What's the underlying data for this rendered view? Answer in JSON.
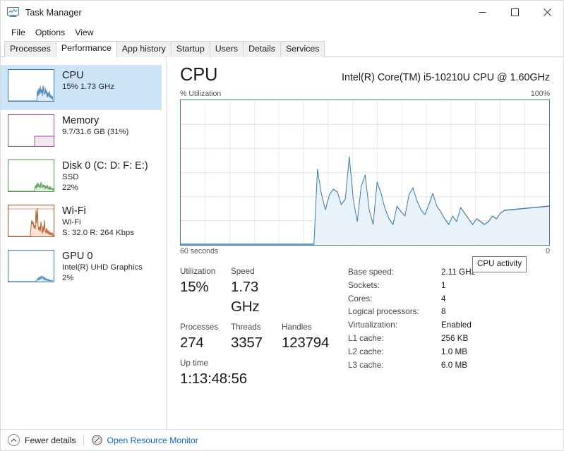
{
  "window": {
    "title": "Task Manager",
    "icon": "task-manager-icon",
    "caption": {
      "minimize": "─",
      "maximize": "□",
      "close": "✕"
    }
  },
  "menubar": {
    "items": [
      "File",
      "Options",
      "View"
    ]
  },
  "tabs": {
    "active": "Performance",
    "items": [
      "Processes",
      "Performance",
      "App history",
      "Startup",
      "Users",
      "Details",
      "Services"
    ]
  },
  "sidebar": {
    "items": [
      {
        "name": "CPU",
        "title": "CPU",
        "sub1": "15%  1.73 GHz",
        "sub2": "",
        "selected": true,
        "color": "#4a90c4"
      },
      {
        "name": "Memory",
        "title": "Memory",
        "sub1": "9.7/31.6 GB (31%)",
        "sub2": "",
        "selected": false,
        "color": "#9b4f96"
      },
      {
        "name": "Disk 0",
        "title": "Disk 0 (C: D: F: E:)",
        "sub1": "SSD",
        "sub2": "22%",
        "selected": false,
        "color": "#4e9a4e"
      },
      {
        "name": "Wi-Fi",
        "title": "Wi-Fi",
        "sub1": "Wi-Fi",
        "sub2": "S: 32.0 R: 264 Kbps",
        "selected": false,
        "color": "#b4521e"
      },
      {
        "name": "GPU 0",
        "title": "GPU 0",
        "sub1": "Intel(R) UHD Graphics",
        "sub2": "2%",
        "selected": false,
        "color": "#3a7cb0"
      }
    ]
  },
  "main": {
    "title": "CPU",
    "model": "Intel(R) Core(TM) i5-10210U CPU @ 1.60GHz",
    "graph_top_left": "% Utilization",
    "graph_top_right": "100%",
    "graph_bottom_left": "60 seconds",
    "graph_bottom_right": "0",
    "tooltip": "CPU activity"
  },
  "stats": {
    "left": [
      {
        "label": "Utilization",
        "value": "15%"
      },
      {
        "label": "Speed",
        "value": "1.73 GHz"
      },
      {
        "label": "Processes",
        "value": "274"
      },
      {
        "label": "Threads",
        "value": "3357"
      },
      {
        "label": "Handles",
        "value": "123794"
      },
      {
        "label": "Up time",
        "value": "1:13:48:56"
      }
    ],
    "right": [
      {
        "key": "Base speed:",
        "value": "2.11 GHz"
      },
      {
        "key": "Sockets:",
        "value": "1"
      },
      {
        "key": "Cores:",
        "value": "4"
      },
      {
        "key": "Logical processors:",
        "value": "8"
      },
      {
        "key": "Virtualization:",
        "value": "Enabled"
      },
      {
        "key": "L1 cache:",
        "value": "256 KB"
      },
      {
        "key": "L2 cache:",
        "value": "1.0 MB"
      },
      {
        "key": "L3 cache:",
        "value": "6.0 MB"
      }
    ]
  },
  "footer": {
    "fewer_details": "Fewer details",
    "resource_monitor": "Open Resource Monitor"
  },
  "colors": {
    "accent_line": "#3a7cb0",
    "accent_fill": "#e8f1f8",
    "selection": "#cce4f7",
    "link": "#0966c2"
  },
  "chart_data": {
    "type": "area",
    "title": "% Utilization",
    "xlabel": "60 seconds",
    "ylabel": "% Utilization",
    "xlim": [
      60,
      0
    ],
    "ylim": [
      0,
      100
    ],
    "grid": true,
    "grid_cols": 15,
    "grid_rows": 5,
    "series": [
      {
        "name": "CPU activity",
        "color": "#3a7cb0",
        "x": [
          60,
          38,
          37.2,
          36.4,
          35.6,
          34.8,
          34,
          33.2,
          32.4,
          31.6,
          30.8,
          30,
          29.2,
          28.4,
          27.6,
          26.8,
          26,
          25.2,
          24.4,
          23.6,
          22.8,
          22,
          21.2,
          20.4,
          19.6,
          18.8,
          18,
          17.2,
          16.4,
          15.6,
          14.8,
          14,
          13.2,
          12.4,
          11.6,
          10.8,
          10,
          9.2,
          8.4,
          7.6,
          6.8,
          6,
          5.2,
          4.4,
          3.6,
          2.8,
          2,
          1.2,
          0.4,
          0
        ],
        "values": [
          0,
          0,
          52,
          35,
          22,
          34,
          38,
          36,
          26,
          30,
          62,
          30,
          12,
          40,
          48,
          20,
          10,
          44,
          36,
          22,
          14,
          10,
          24,
          20,
          16,
          34,
          40,
          30,
          22,
          18,
          26,
          34,
          24,
          20,
          14,
          10,
          16,
          12,
          22,
          18,
          14,
          10,
          14,
          12,
          10,
          12,
          16,
          14,
          18,
          20
        ]
      }
    ]
  }
}
